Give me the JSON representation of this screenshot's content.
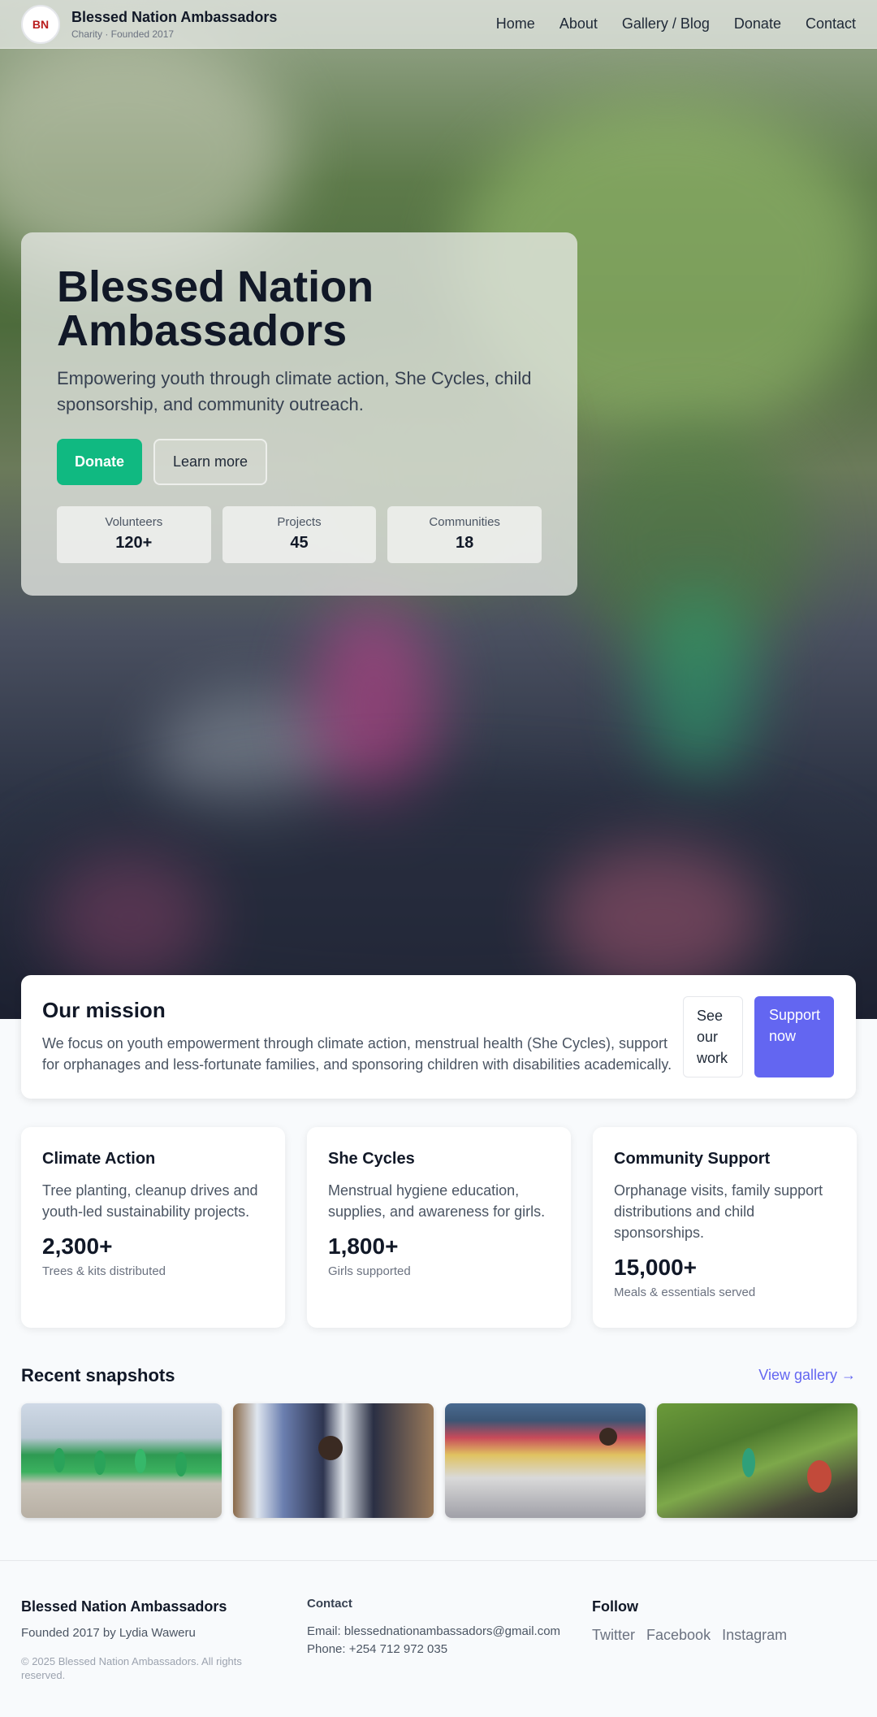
{
  "header": {
    "logo_text": "BN",
    "brand_name": "Blessed Nation Ambassadors",
    "brand_sub": "Charity · Founded 2017",
    "nav": [
      "Home",
      "About",
      "Gallery / Blog",
      "Donate",
      "Contact"
    ]
  },
  "hero": {
    "title": "Blessed Nation\nAmbassadors",
    "subtitle": "Empowering youth through climate action, She Cycles, child sponsorship, and community outreach.",
    "donate_label": "Donate",
    "learn_label": "Learn more",
    "stats": [
      {
        "label": "Volunteers",
        "value": "120+"
      },
      {
        "label": "Projects",
        "value": "45"
      },
      {
        "label": "Communities",
        "value": "18"
      }
    ]
  },
  "mission": {
    "title": "Our mission",
    "text": "We focus on youth empowerment through climate action, menstrual health (She Cycles), support for orphanages and less-fortunate families, and sponsoring children with disabilities academically.",
    "see_work_label": "See our work",
    "support_label": "Support now"
  },
  "programs": [
    {
      "title": "Climate Action",
      "text": "Tree planting, cleanup drives and youth-led sustainability projects.",
      "number": "2,300+",
      "caption": "Trees & kits distributed"
    },
    {
      "title": "She Cycles",
      "text": "Menstrual hygiene education, supplies, and awareness for girls.",
      "number": "1,800+",
      "caption": "Girls supported"
    },
    {
      "title": "Community Support",
      "text": "Orphanage visits, family support distributions and child sponsorships.",
      "number": "15,000+",
      "caption": "Meals & essentials served"
    }
  ],
  "snapshots": {
    "title": "Recent snapshots",
    "link_label": "View gallery →"
  },
  "footer": {
    "brand": "Blessed Nation Ambassadors",
    "founded": "Founded 2017 by Lydia Waweru",
    "copyright": "© 2025 Blessed Nation Ambassadors. All rights reserved.",
    "contact_heading": "Contact",
    "email": "Email: blessednationambassadors@gmail.com",
    "phone": "Phone: +254 712 972 035",
    "follow_heading": "Follow",
    "socials": [
      "Twitter",
      "Facebook",
      "Instagram"
    ]
  },
  "colors": {
    "accent": "#6366f1",
    "donate": "#10b981"
  }
}
